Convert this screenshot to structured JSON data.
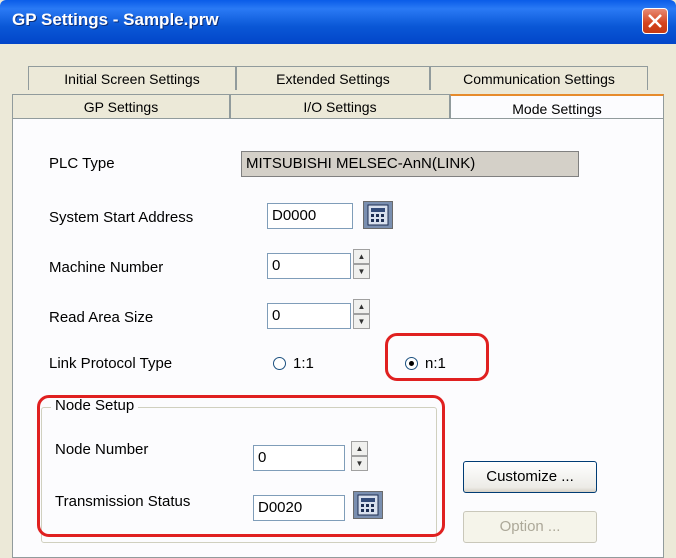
{
  "window": {
    "title": "GP Settings - Sample.prw"
  },
  "tabs": {
    "row1": [
      "Initial Screen Settings",
      "Extended Settings",
      "Communication Settings"
    ],
    "row2": [
      "GP Settings",
      "I/O Settings",
      "Mode Settings"
    ],
    "selected": "Mode Settings"
  },
  "form": {
    "plc_type": {
      "label": "PLC Type",
      "value": "MITSUBISHI MELSEC-AnN(LINK)"
    },
    "system_start_address": {
      "label": "System Start Address",
      "value": "D0000"
    },
    "machine_number": {
      "label": "Machine Number",
      "value": "0"
    },
    "read_area_size": {
      "label": "Read Area Size",
      "value": "0"
    },
    "link_protocol": {
      "label": "Link Protocol Type",
      "options": [
        "1:1",
        "n:1"
      ],
      "selected": "n:1"
    }
  },
  "node_setup": {
    "title": "Node Setup",
    "node_number": {
      "label": "Node Number",
      "value": "0"
    },
    "transmission_status": {
      "label": "Transmission Status",
      "value": "D0020"
    }
  },
  "buttons": {
    "customize": "Customize ...",
    "option": "Option ..."
  },
  "colors": {
    "title_bar": "#0a57d6",
    "highlight": "#e02020",
    "window_bg": "#ece9d8"
  }
}
